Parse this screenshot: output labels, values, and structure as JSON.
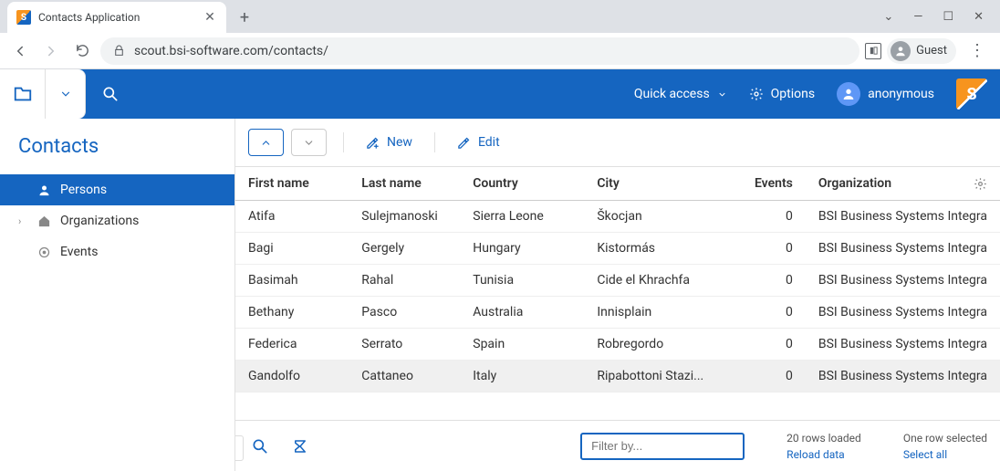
{
  "browser": {
    "tab_title": "Contacts Application",
    "url": "scout.bsi-software.com/contacts/",
    "guest_label": "Guest"
  },
  "header": {
    "quick_access": "Quick access",
    "options": "Options",
    "username": "anonymous"
  },
  "sidebar": {
    "title": "Contacts",
    "items": [
      {
        "label": "Persons"
      },
      {
        "label": "Organizations"
      },
      {
        "label": "Events"
      }
    ]
  },
  "toolbar": {
    "new_label": "New",
    "edit_label": "Edit"
  },
  "table": {
    "columns": [
      "First name",
      "Last name",
      "Country",
      "City",
      "Events",
      "Organization"
    ],
    "rows": [
      {
        "first": "Atifa",
        "last": "Sulejmanoski",
        "country": "Sierra Leone",
        "city": "Škocjan",
        "events": "0",
        "org": "BSI Business Systems Integra"
      },
      {
        "first": "Bagi",
        "last": "Gergely",
        "country": "Hungary",
        "city": "Kistormás",
        "events": "0",
        "org": "BSI Business Systems Integra"
      },
      {
        "first": "Basimah",
        "last": "Rahal",
        "country": "Tunisia",
        "city": "Cide el Khrachfa",
        "events": "0",
        "org": "BSI Business Systems Integra"
      },
      {
        "first": "Bethany",
        "last": "Pasco",
        "country": "Australia",
        "city": "Innisplain",
        "events": "0",
        "org": "BSI Business Systems Integra"
      },
      {
        "first": "Federica",
        "last": "Serrato",
        "country": "Spain",
        "city": "Robregordo",
        "events": "0",
        "org": "BSI Business Systems Integra"
      },
      {
        "first": "Gandolfo",
        "last": "Cattaneo",
        "country": "Italy",
        "city": "Ripabottoni Stazi...",
        "events": "0",
        "org": "BSI Business Systems Integra"
      }
    ]
  },
  "footer": {
    "filter_placeholder": "Filter by...",
    "rows_loaded": "20 rows loaded",
    "reload": "Reload data",
    "selected": "One row selected",
    "select_all": "Select all"
  }
}
